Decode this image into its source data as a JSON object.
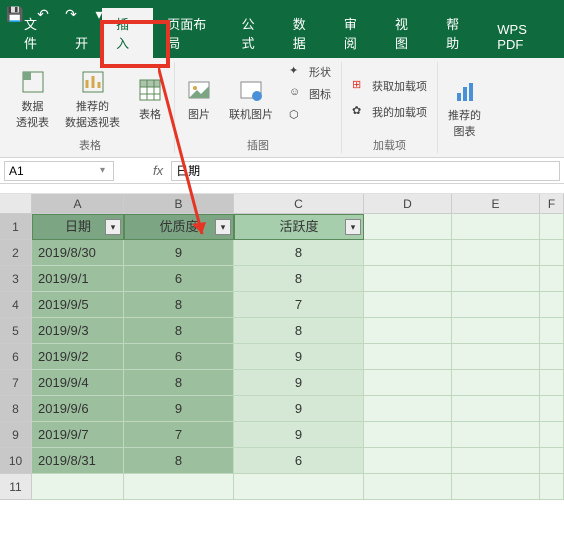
{
  "titlebar": {
    "save": "💾",
    "undo": "↶",
    "redo": "↷",
    "more": "▾"
  },
  "tabs": {
    "file": "文件",
    "home": "开",
    "insert": "插入",
    "page_layout": "页面布局",
    "formulas": "公式",
    "data": "数据",
    "review": "审阅",
    "view": "视图",
    "help": "帮助",
    "wps": "WPS PDF"
  },
  "ribbon": {
    "pivot": "数据\n透视表",
    "rec_pivot": "推荐的\n数据透视表",
    "table": "表格",
    "pictures": "图片",
    "online_pic": "联机图片",
    "shapes": "形状",
    "icons": "图标",
    "model": "",
    "group_illust": "插图",
    "get_addins": "获取加载项",
    "my_addins": "我的加载项",
    "group_addins": "加载项",
    "rec_charts": "推荐的\n图表",
    "group_tables": "表格"
  },
  "namebox": {
    "ref": "A1"
  },
  "formula": {
    "value": "日期",
    "fx": "fx"
  },
  "cols": {
    "A": "A",
    "B": "B",
    "C": "C",
    "D": "D",
    "E": "E",
    "F": "F"
  },
  "headers": {
    "date": "日期",
    "quality": "优质度",
    "active": "活跃度"
  },
  "rows": [
    {
      "n": "1"
    },
    {
      "n": "2",
      "date": "2019/8/30",
      "q": "9",
      "a": "8"
    },
    {
      "n": "3",
      "date": "2019/9/1",
      "q": "6",
      "a": "8"
    },
    {
      "n": "4",
      "date": "2019/9/5",
      "q": "8",
      "a": "7"
    },
    {
      "n": "5",
      "date": "2019/9/3",
      "q": "8",
      "a": "8"
    },
    {
      "n": "6",
      "date": "2019/9/2",
      "q": "6",
      "a": "9"
    },
    {
      "n": "7",
      "date": "2019/9/4",
      "q": "8",
      "a": "9"
    },
    {
      "n": "8",
      "date": "2019/9/6",
      "q": "9",
      "a": "9"
    },
    {
      "n": "9",
      "date": "2019/9/7",
      "q": "7",
      "a": "9"
    },
    {
      "n": "10",
      "date": "2019/8/31",
      "q": "8",
      "a": "6"
    },
    {
      "n": "11"
    }
  ]
}
